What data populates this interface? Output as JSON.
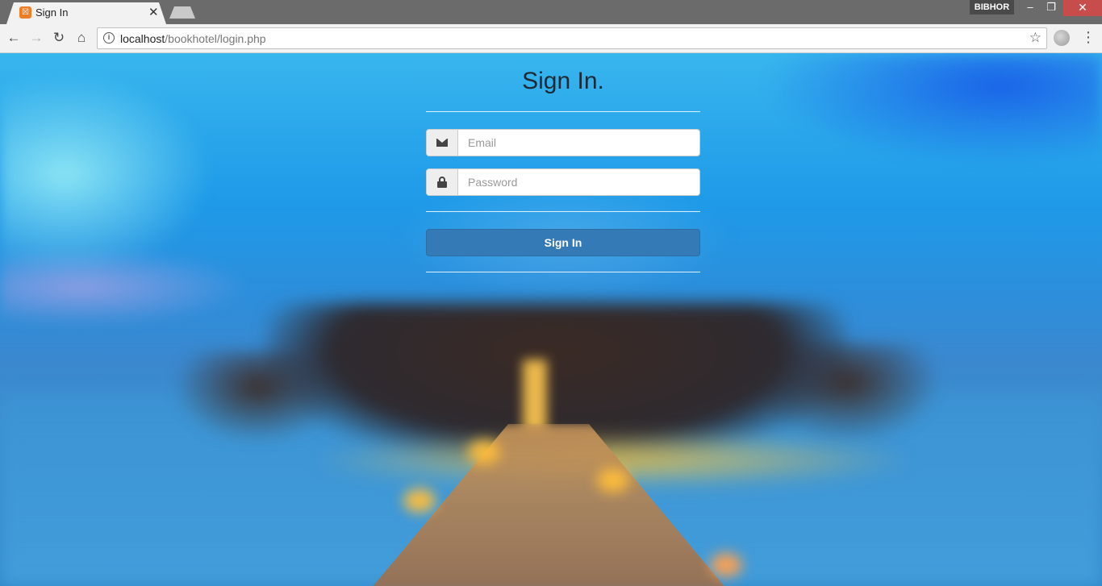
{
  "browser": {
    "tab_title": "Sign In",
    "tab_favicon_glyph": "☒",
    "tab_close_glyph": "✕",
    "profile_name": "BIBHOR",
    "url_host": "localhost",
    "url_path": "/bookhotel/login.php",
    "window_controls": {
      "minimize": "–",
      "restore": "❐",
      "close": "✕"
    },
    "nav": {
      "back": "←",
      "forward": "→",
      "reload": "↻",
      "home": "⌂"
    },
    "star_glyph": "☆",
    "menu_glyph": "⋮",
    "info_glyph": "i"
  },
  "login": {
    "title": "Sign In.",
    "email_placeholder": "Email",
    "password_placeholder": "Password",
    "submit_label": "Sign In"
  },
  "icons": {
    "email_addon": "envelope-icon",
    "password_addon": "lock-icon"
  },
  "colors": {
    "primary_button": "#337ab7",
    "favicon": "#f07d21",
    "close_button": "#c74d4d"
  }
}
